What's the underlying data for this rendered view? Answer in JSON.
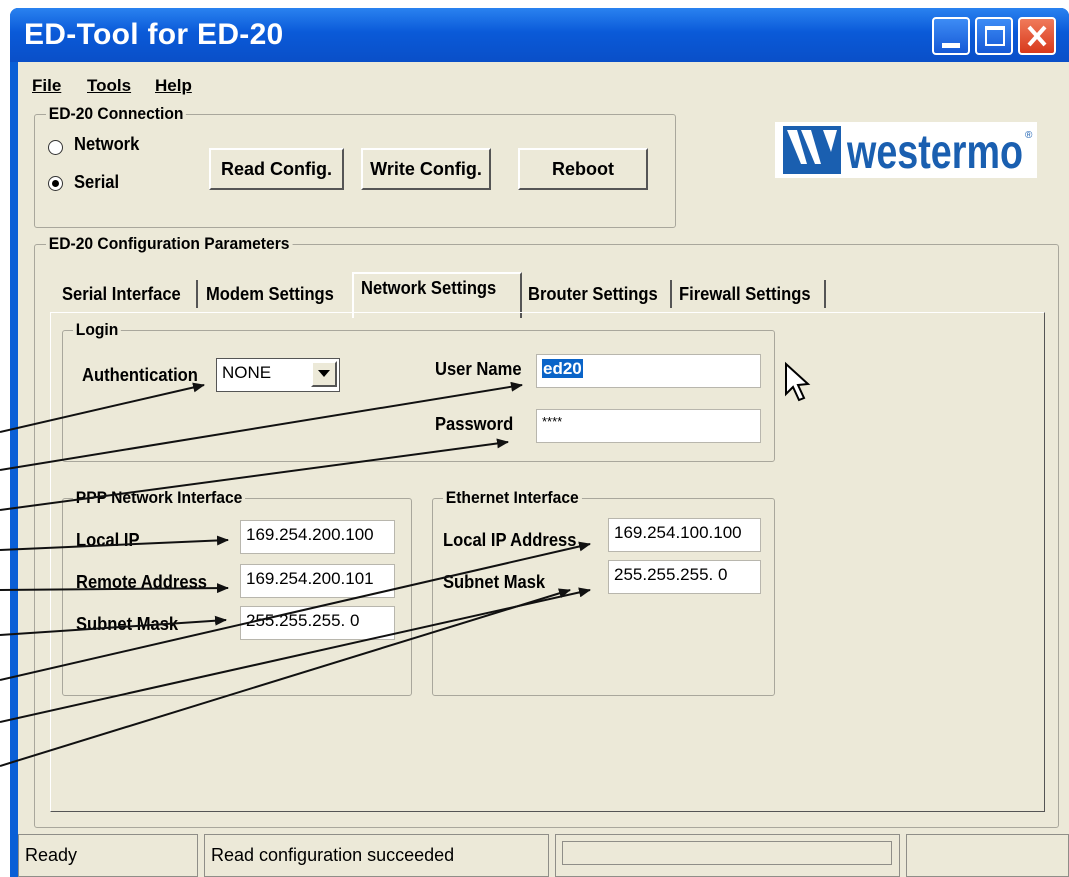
{
  "window": {
    "title": "ED-Tool for ED-20"
  },
  "menu": {
    "file": "File",
    "tools": "Tools",
    "help": "Help"
  },
  "connection": {
    "legend": "ED-20 Connection",
    "network_label": "Network",
    "serial_label": "Serial",
    "selected": "Serial",
    "read_button": "Read Config.",
    "write_button": "Write Config.",
    "reboot_button": "Reboot"
  },
  "logo": {
    "text": "westermo",
    "registered": "®"
  },
  "config": {
    "legend": "ED-20 Configuration Parameters",
    "tabs": [
      "Serial Interface",
      "Modem Settings",
      "Network Settings",
      "Brouter Settings",
      "Firewall Settings"
    ],
    "active_tab": "Network Settings"
  },
  "login": {
    "legend": "Login",
    "auth_label": "Authentication",
    "auth_value": "NONE",
    "user_label": "User Name",
    "user_value": "ed20",
    "password_label": "Password",
    "password_value": "****"
  },
  "ppp": {
    "legend": "PPP Network Interface",
    "local_ip_label": "Local IP",
    "local_ip_value": "169.254.200.100",
    "remote_label": "Remote Address",
    "remote_value": "169.254.200.101",
    "subnet_label": "Subnet Mask",
    "subnet_value": "255.255.255.  0"
  },
  "ethernet": {
    "legend": "Ethernet Interface",
    "local_ip_label": "Local IP Address",
    "local_ip_value": "169.254.100.100",
    "subnet_label": "Subnet Mask",
    "subnet_value": "255.255.255.  0"
  },
  "statusbar": {
    "ready": "Ready",
    "message": "Read configuration succeeded"
  },
  "colors": {
    "titlebar": "#0a5ad8",
    "face": "#ece9d8",
    "selection": "#0a64c8",
    "logo_blue": "#1a5fb0"
  }
}
